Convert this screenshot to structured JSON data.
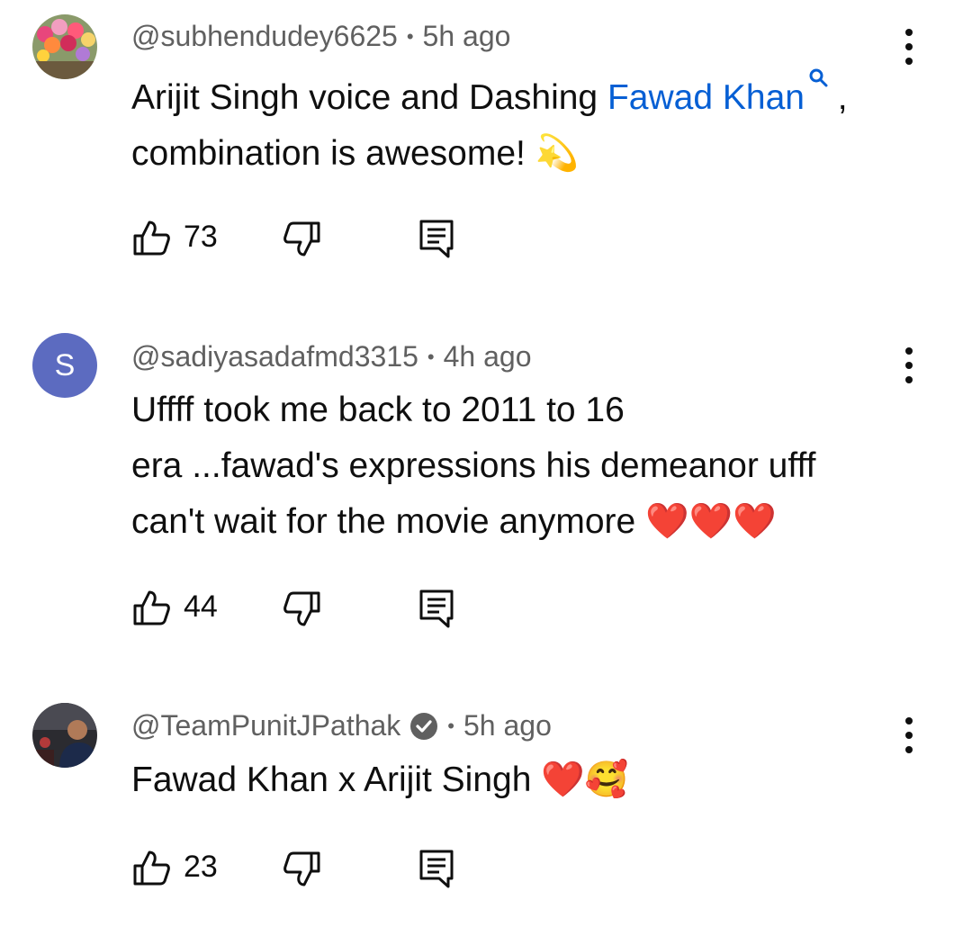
{
  "comments": [
    {
      "author": "@subhendudey6625",
      "time": "5h ago",
      "avatar": "flower-photo",
      "text_before": "Arijit Singh voice and Dashing ",
      "link_text": "Fawad Khan",
      "text_after": " ,",
      "line2": "combination is awesome! ",
      "emoji": "💫",
      "likes": "73"
    },
    {
      "author": "@sadiyasadafmd3315",
      "time": "4h ago",
      "avatar_letter": "S",
      "avatar_color": "#5c6bc0",
      "line1": "Uffff took me back to 2011 to 16",
      "line2": "era ...fawad's expressions his demeanor ufff",
      "line3": "can't wait for the movie anymore ",
      "emoji": "❤️❤️❤️",
      "likes": "44"
    },
    {
      "author": "@TeamPunitJPathak",
      "time": "5h ago",
      "verified": true,
      "avatar": "person-photo",
      "text": "Fawad Khan x Arijit Singh ",
      "emoji": "❤️🥰",
      "likes": "23"
    }
  ],
  "colors": {
    "link": "#065fd4",
    "meta": "#606060",
    "text": "#0f0f0f"
  }
}
